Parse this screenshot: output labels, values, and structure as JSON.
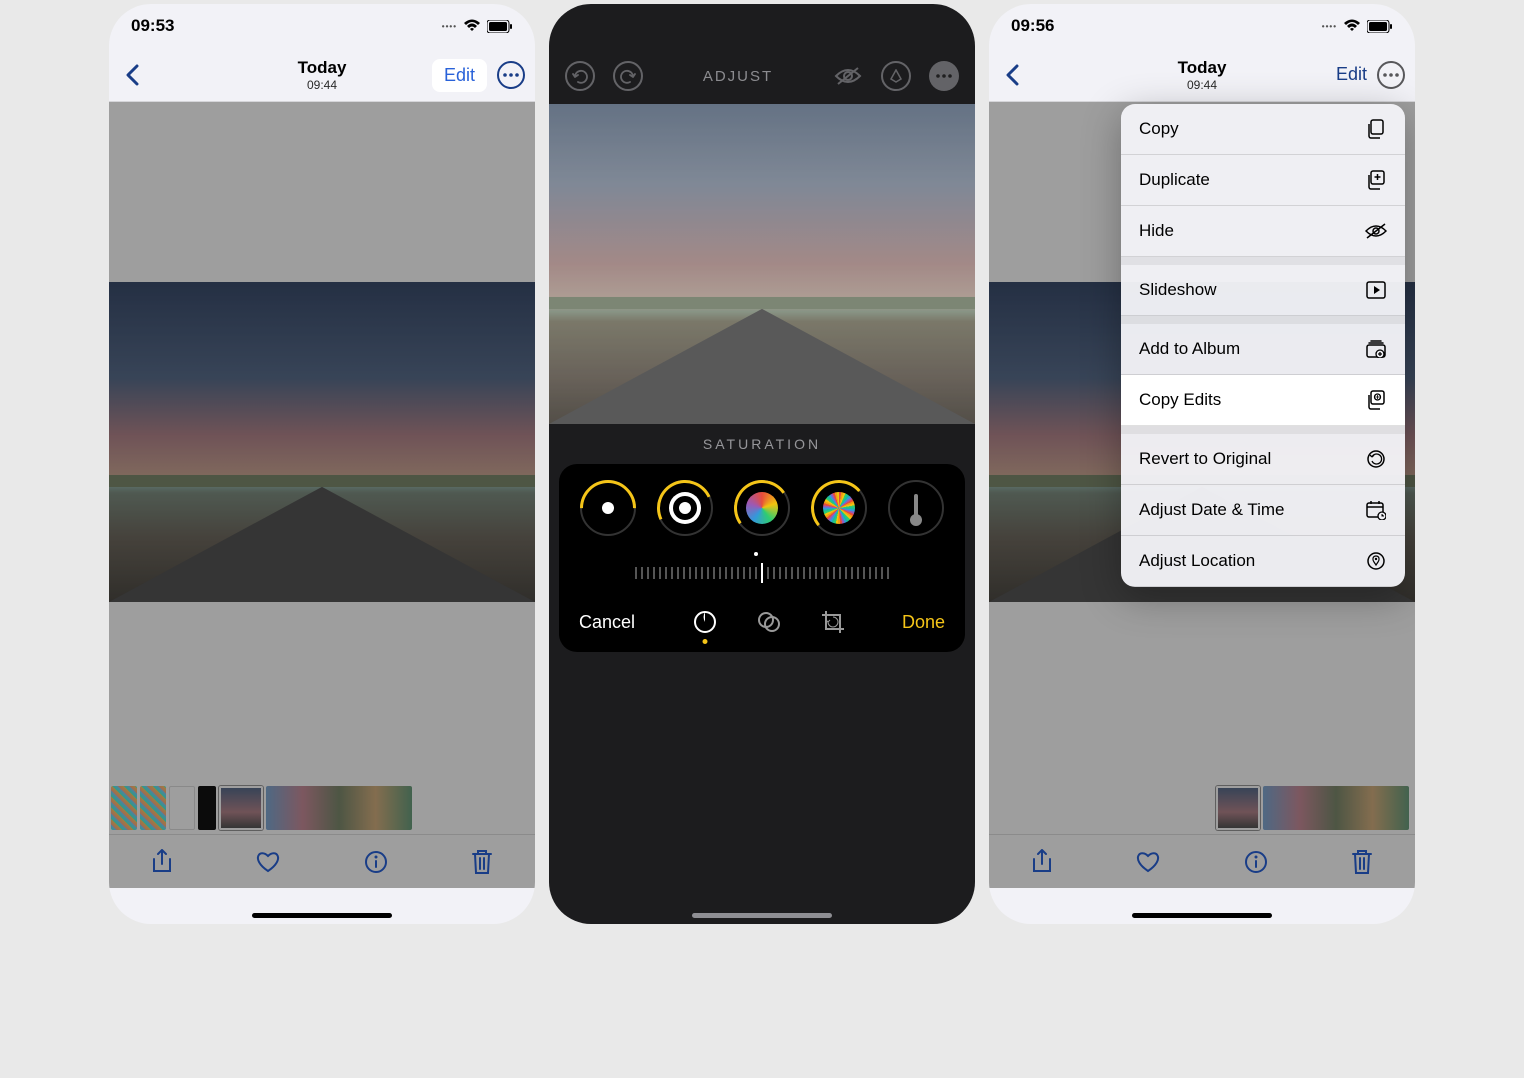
{
  "phoneA": {
    "status": {
      "time": "09:53"
    },
    "nav": {
      "title": "Today",
      "subtitle": "09:44",
      "edit": "Edit"
    }
  },
  "phoneB": {
    "top": {
      "title": "ADJUST"
    },
    "slider_label": "SATURATION",
    "bottom": {
      "cancel": "Cancel",
      "done": "Done"
    }
  },
  "phoneC": {
    "status": {
      "time": "09:56"
    },
    "nav": {
      "title": "Today",
      "subtitle": "09:44",
      "edit": "Edit"
    },
    "menu": {
      "items": [
        {
          "label": "Copy",
          "icon": "copy"
        },
        {
          "label": "Duplicate",
          "icon": "duplicate"
        },
        {
          "label": "Hide",
          "icon": "hide"
        },
        {
          "label": "Slideshow",
          "icon": "slideshow"
        },
        {
          "label": "Add to Album",
          "icon": "album"
        },
        {
          "label": "Copy Edits",
          "icon": "copyedits",
          "highlight": true
        },
        {
          "label": "Revert to Original",
          "icon": "revert"
        },
        {
          "label": "Adjust Date & Time",
          "icon": "calendar"
        },
        {
          "label": "Adjust Location",
          "icon": "location"
        }
      ]
    }
  }
}
